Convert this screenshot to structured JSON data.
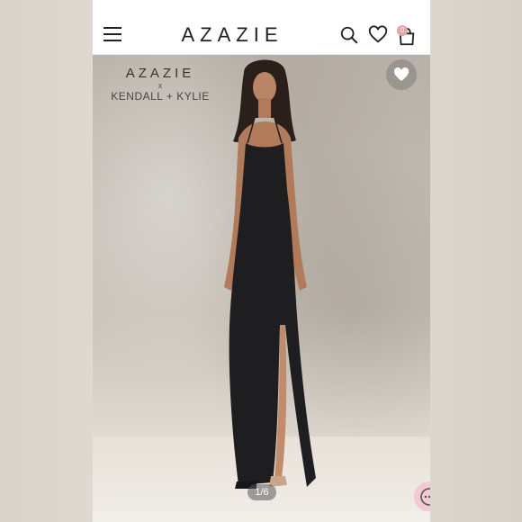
{
  "header": {
    "brand": "AZAZIE",
    "menu_icon": "hamburger-menu-icon",
    "search_icon": "search-icon",
    "wishlist_icon": "heart-outline-icon",
    "cart_icon": "shopping-bag-icon",
    "cart_count": "0"
  },
  "hero": {
    "collab_brand": "AZAZIE",
    "collab_x": "x",
    "collab_partner": "KENDALL + KYLIE",
    "favorite_icon": "heart-filled-icon",
    "image_counter": "1/6",
    "chat_icon": "chat-bubble-icon"
  },
  "colors": {
    "accent_pink": "#f3c9d3",
    "badge_pink": "#e7a4a4",
    "dress": "#1e1e20"
  }
}
